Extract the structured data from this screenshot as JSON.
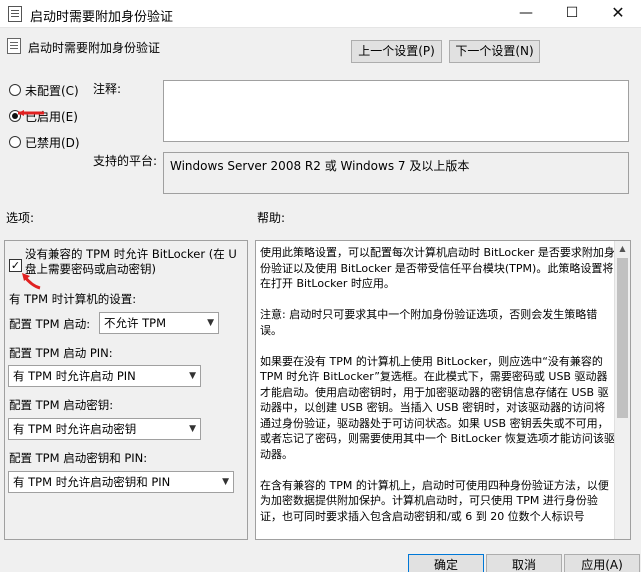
{
  "window": {
    "title": "启动时需要附加身份验证",
    "min_glyph": "—",
    "max_glyph": "☐",
    "close_glyph": "✕"
  },
  "header": {
    "title": "启动时需要附加身份验证",
    "prev_button": "上一个设置(P)",
    "next_button": "下一个设置(N)"
  },
  "state": {
    "options": [
      {
        "label": "未配置(C)",
        "checked": false
      },
      {
        "label": "已启用(E)",
        "checked": true
      },
      {
        "label": "已禁用(D)",
        "checked": false
      }
    ]
  },
  "labels": {
    "comment": "注释:",
    "platform": "支持的平台:",
    "options": "选项:",
    "help": "帮助:"
  },
  "platform_value": "Windows Server 2008 R2 或 Windows 7 及以上版本",
  "options_panel": {
    "checkbox_label": "没有兼容的 TPM 时允许 BitLocker (在 U 盘上需要密码或启动密钥)",
    "checkbox_checked": true,
    "tpm_section": "有 TPM 时计算机的设置:",
    "tpm_startup_label": "配置 TPM 启动:",
    "tpm_startup_value": "不允许 TPM",
    "tpm_pin_label": "配置 TPM 启动 PIN:",
    "tpm_pin_value": "有 TPM 时允许启动 PIN",
    "tpm_key_label": "配置 TPM 启动密钥:",
    "tpm_key_value": "有 TPM 时允许启动密钥",
    "tpm_key_pin_label": "配置 TPM 启动密钥和 PIN:",
    "tpm_key_pin_value": "有 TPM 时允许启动密钥和 PIN"
  },
  "help_text": {
    "p1": "使用此策略设置，可以配置每次计算机启动时 BitLocker 是否要求附加身份验证以及使用 BitLocker 是否带受信任平台模块(TPM)。此策略设置将在打开 BitLocker 时应用。",
    "p2": "注意: 启动时只可要求其中一个附加身份验证选项，否则会发生策略错误。",
    "p3": "如果要在没有 TPM 的计算机上使用 BitLocker，则应选中“没有兼容的 TPM 时允许 BitLocker”复选框。在此模式下，需要密码或 USB 驱动器才能启动。使用启动密钥时，用于加密驱动器的密钥信息存储在 USB 驱动器中，以创建 USB 密钥。当插入 USB 密钥时，对该驱动器的访问将通过身份验证，驱动器处于可访问状态。如果 USB 密钥丢失或不可用，或者忘记了密码，则需要使用其中一个 BitLocker 恢复选项才能访问该驱动器。",
    "p4": "在含有兼容的 TPM 的计算机上，启动时可使用四种身份验证方法，以便为加密数据提供附加保护。计算机启动时，可只使用 TPM 进行身份验证，也可同时要求插入包含启动密钥和/或 6 到 20 位数个人标识号"
  },
  "buttons": {
    "ok": "确定",
    "cancel": "取消",
    "apply": "应用(A)"
  }
}
